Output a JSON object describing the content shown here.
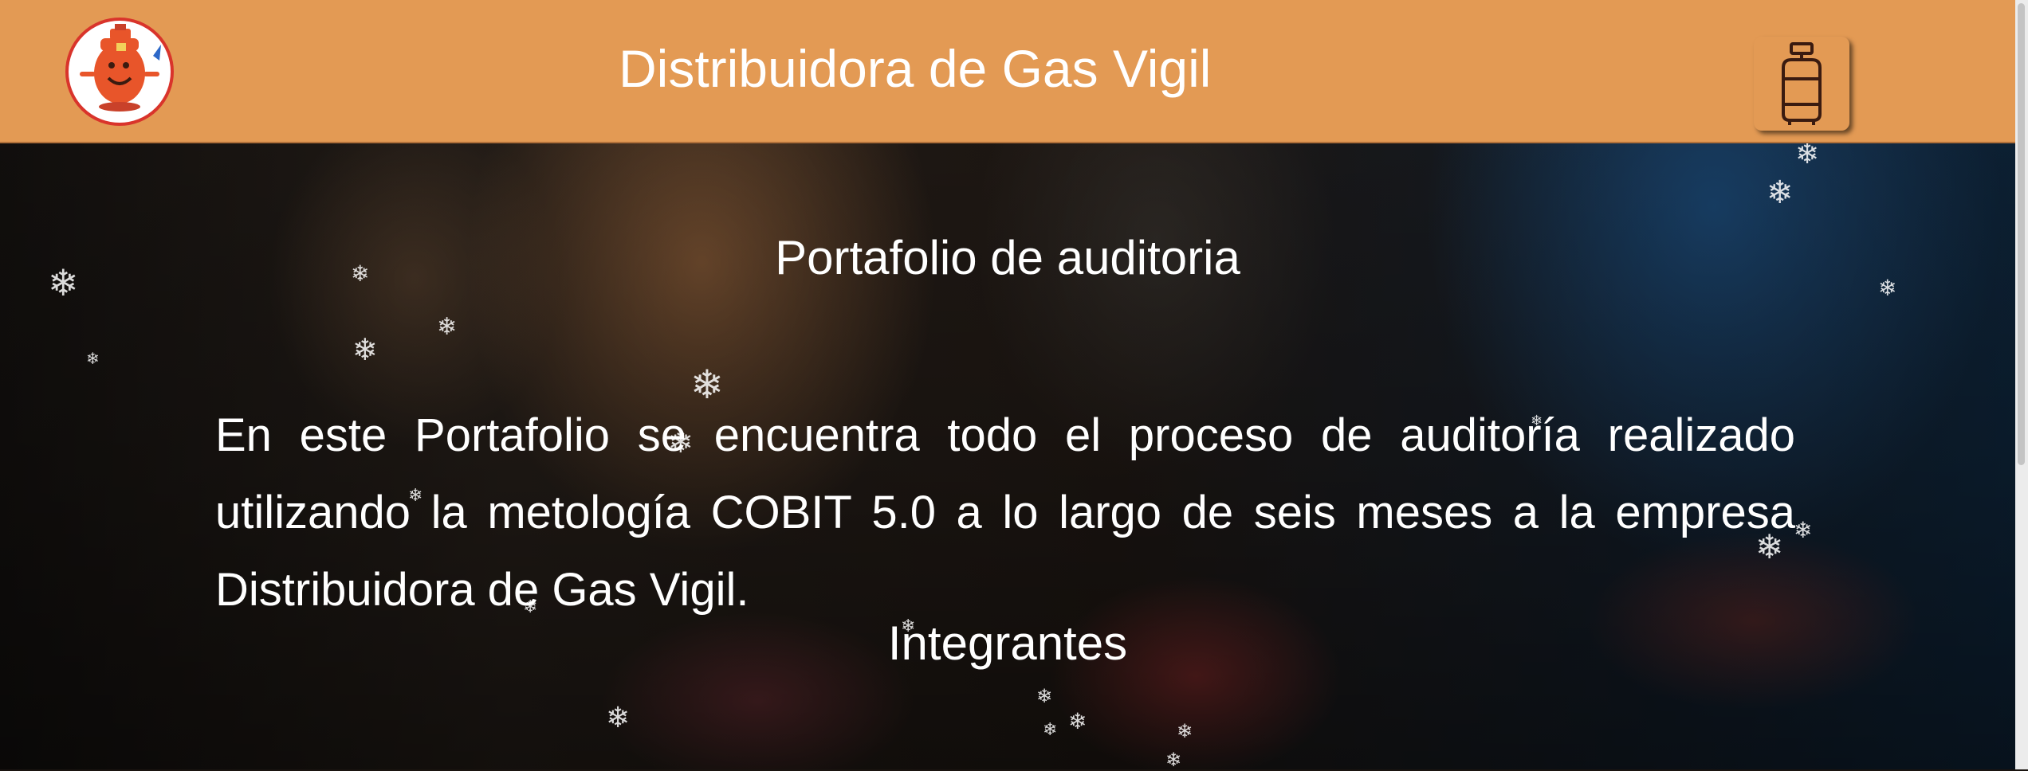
{
  "header": {
    "title": "Distribuidora de Gas Vigil",
    "logo_icon": "gas-cylinder-mascot-logo",
    "cart_icon": "gas-cylinder-icon"
  },
  "main": {
    "heading": "Portafolio de auditoria",
    "intro": "En este Portafolio se encuentra todo el proceso de auditoría realizado utilizando la metología COBIT 5.0 a lo largo de seis meses a la empresa Distribuidora de Gas Vigil.",
    "members_heading": "Integrantes"
  },
  "colors": {
    "header_bg": "#e39a54",
    "text": "#ffffff",
    "logo_ring": "#d9342b",
    "mascot": "#e8552a"
  }
}
